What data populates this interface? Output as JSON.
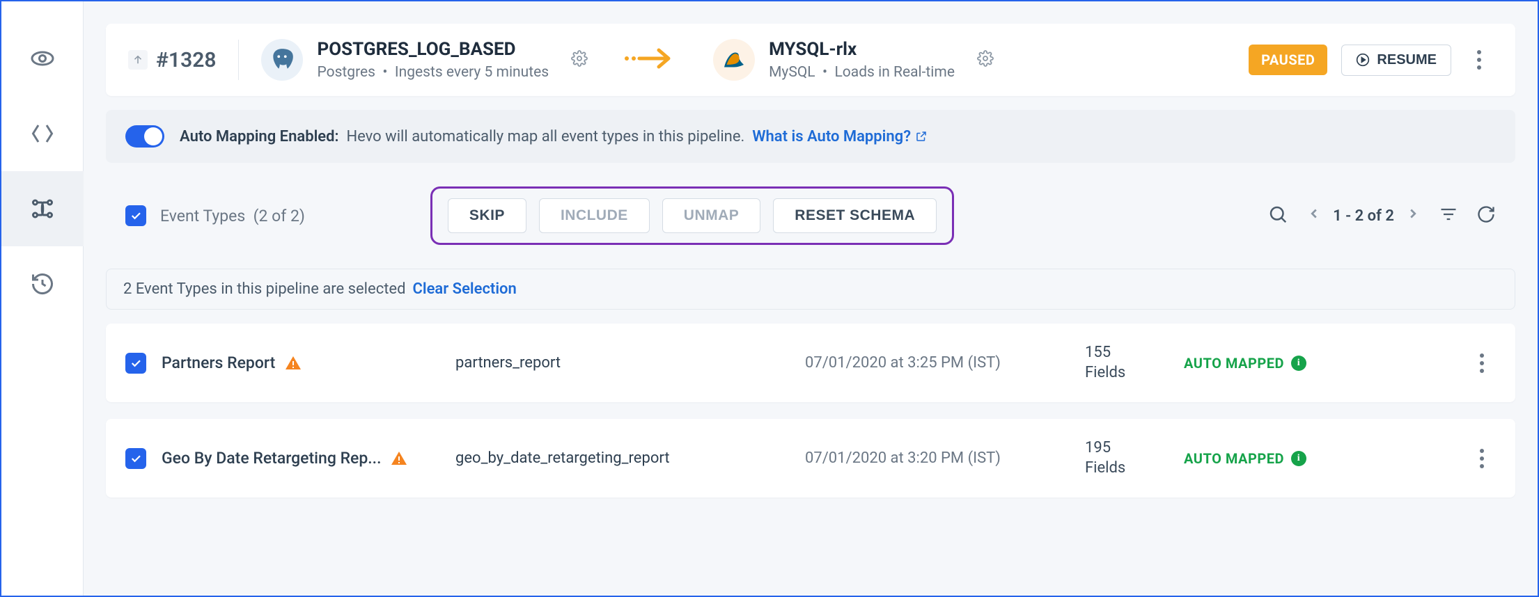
{
  "pipeline": {
    "id": "#1328",
    "source": {
      "name": "POSTGRES_LOG_BASED",
      "type": "Postgres",
      "schedule": "Ingests every 5 minutes"
    },
    "dest": {
      "name": "MYSQL-rlx",
      "type": "MySQL",
      "schedule": "Loads in Real-time"
    },
    "status_badge": "PAUSED",
    "resume_label": "RESUME"
  },
  "automap": {
    "title": "Auto Mapping Enabled:",
    "desc": "Hevo will automatically map all event types in this pipeline.",
    "link": "What is Auto Mapping?"
  },
  "toolbar": {
    "label": "Event Types",
    "count": "(2 of 2)",
    "actions": {
      "skip": "SKIP",
      "include": "INCLUDE",
      "unmap": "UNMAP",
      "reset": "RESET SCHEMA"
    },
    "pager": "1 - 2 of 2"
  },
  "selection": {
    "text": "2 Event Types in this pipeline are selected",
    "clear": "Clear Selection"
  },
  "rows": [
    {
      "name": "Partners Report",
      "slug": "partners_report",
      "date": "07/01/2020 at 3:25 PM (IST)",
      "fields": "155",
      "fields_label": "Fields",
      "status": "AUTO MAPPED"
    },
    {
      "name": "Geo By Date Retargeting Rep...",
      "slug": "geo_by_date_retargeting_report",
      "date": "07/01/2020 at 3:20 PM (IST)",
      "fields": "195",
      "fields_label": "Fields",
      "status": "AUTO MAPPED"
    }
  ]
}
